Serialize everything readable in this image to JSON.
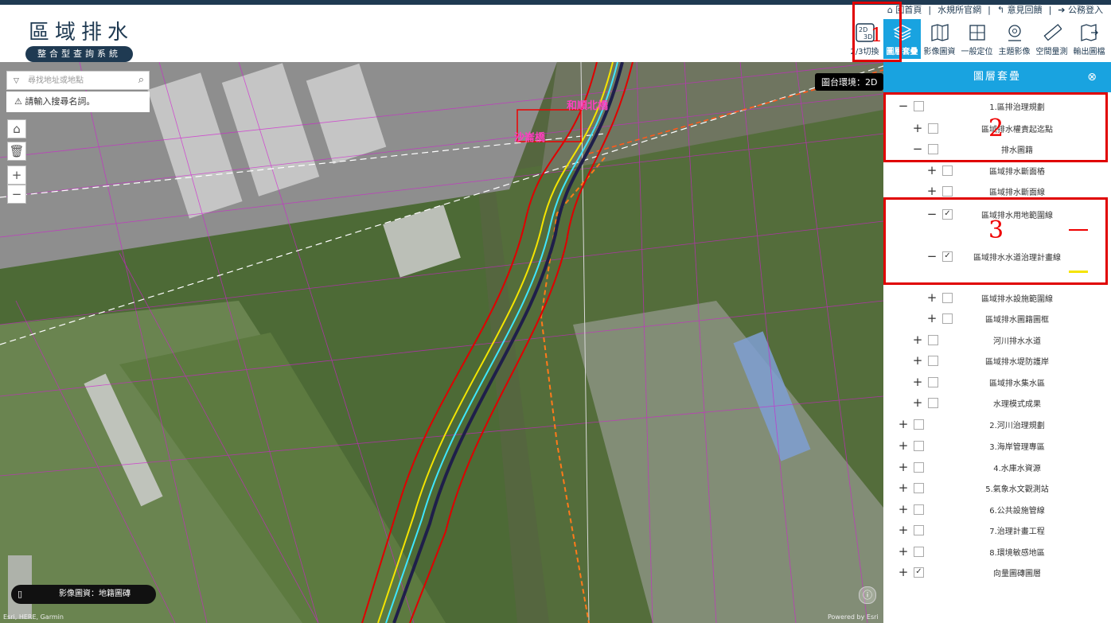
{
  "header": {
    "title": "區域排水",
    "subtitle": "整合型查詢系統",
    "links": [
      "回首頁",
      "水規所官網",
      "意見回饋",
      "公務登入"
    ],
    "tools": [
      {
        "label": "2/3切換",
        "icon": "2d-3d-icon"
      },
      {
        "label": "圖層套疊",
        "icon": "layers-icon"
      },
      {
        "label": "影像圖資",
        "icon": "map-image-icon"
      },
      {
        "label": "一般定位",
        "icon": "locate-icon"
      },
      {
        "label": "主題影像",
        "icon": "theme-image-icon"
      },
      {
        "label": "空間量測",
        "icon": "ruler-icon"
      },
      {
        "label": "輸出圖檔",
        "icon": "export-map-icon"
      }
    ]
  },
  "map": {
    "search_placeholder": "尋找地址或地點",
    "warning": "請輸入搜尋名詞。",
    "mode_badge": "圖台環境：2D",
    "basemap_label": "影像圖資：地籍圖磚",
    "attribution": "Esri, HERE, Garmin",
    "powered": "Powered by Esri",
    "labels": [
      "和順北橋",
      "沙崙橋"
    ]
  },
  "panel": {
    "title": "圖層套疊",
    "rows": [
      {
        "label": "1.區排治理規劃",
        "toggle": "−",
        "checked": false,
        "level": 0
      },
      {
        "label": "區域排水權責起迄點",
        "toggle": "+",
        "checked": false,
        "level": 1
      },
      {
        "label": "排水圖籍",
        "toggle": "−",
        "checked": false,
        "level": 1
      },
      {
        "label": "區域排水斷面樁",
        "toggle": "+",
        "checked": false,
        "level": 2
      },
      {
        "label": "區域排水斷面線",
        "toggle": "+",
        "checked": false,
        "level": 2
      },
      {
        "label": "區域排水用地範圍線",
        "toggle": "−",
        "checked": true,
        "level": 2
      },
      {
        "label": "區域排水水道治理計畫線",
        "toggle": "−",
        "checked": true,
        "level": 2
      },
      {
        "label": "區域排水設施範圍線",
        "toggle": "+",
        "checked": false,
        "level": 2
      },
      {
        "label": "區域排水圖籍圖框",
        "toggle": "+",
        "checked": false,
        "level": 2
      },
      {
        "label": "河川排水水道",
        "toggle": "+",
        "checked": false,
        "level": 1
      },
      {
        "label": "區域排水堤防護岸",
        "toggle": "+",
        "checked": false,
        "level": 1
      },
      {
        "label": "區域排水集水區",
        "toggle": "+",
        "checked": false,
        "level": 1
      },
      {
        "label": "水理模式成果",
        "toggle": "+",
        "checked": false,
        "level": 1
      },
      {
        "label": "2.河川治理規劃",
        "toggle": "+",
        "checked": false,
        "level": 0
      },
      {
        "label": "3.海岸管理專區",
        "toggle": "+",
        "checked": false,
        "level": 0
      },
      {
        "label": "4.水庫水資源",
        "toggle": "+",
        "checked": false,
        "level": 0
      },
      {
        "label": "5.氣象水文觀測站",
        "toggle": "+",
        "checked": false,
        "level": 0
      },
      {
        "label": "6.公共設施管線",
        "toggle": "+",
        "checked": false,
        "level": 0
      },
      {
        "label": "7.治理計畫工程",
        "toggle": "+",
        "checked": false,
        "level": 0
      },
      {
        "label": "8.環境敏感地區",
        "toggle": "+",
        "checked": false,
        "level": 0
      },
      {
        "label": "向量圖磚圖層",
        "toggle": "+",
        "checked": true,
        "level": 0
      }
    ]
  },
  "annotations": [
    "1",
    "2",
    "3"
  ],
  "colors": {
    "accent": "#19a3e0",
    "navy": "#1f3a52",
    "highlight": "#e00000"
  }
}
